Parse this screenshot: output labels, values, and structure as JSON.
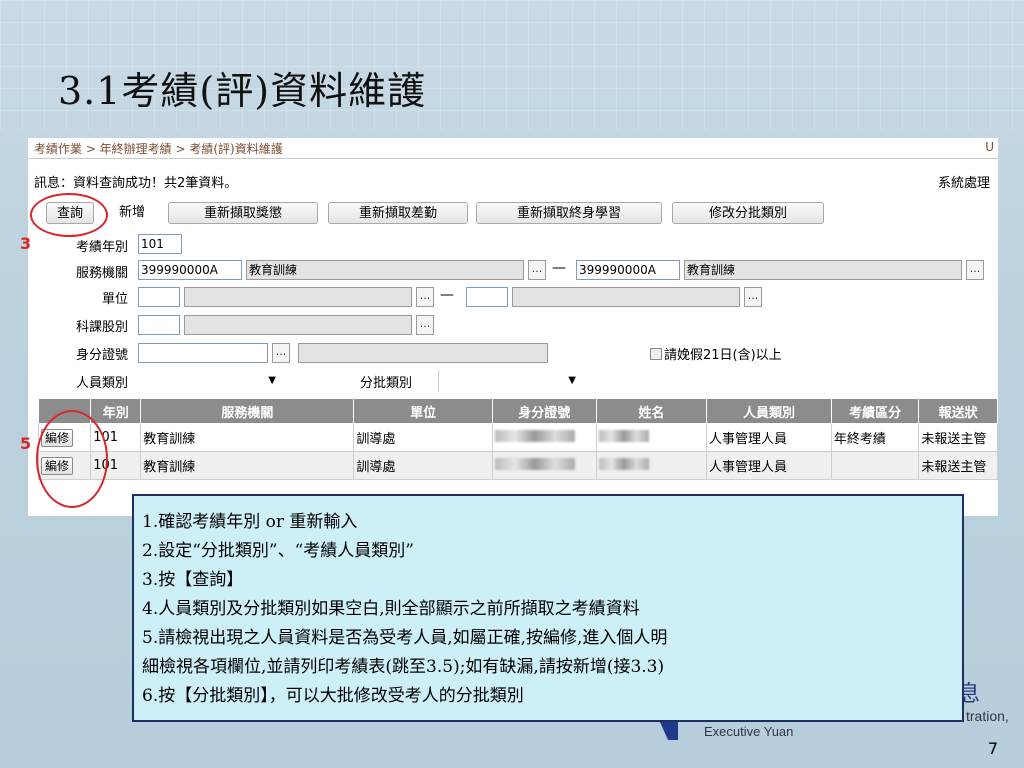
{
  "slide": {
    "title": "3.1考績(評)資料維護",
    "page_number": "7",
    "logo_text_1": "tration,",
    "logo_text_2": "Executive Yuan",
    "logo_glyph": "息"
  },
  "app": {
    "breadcrumb": "考績作業 > 年終辦理考績 > 考績(評)資料維護",
    "crumb_right": "U",
    "message": "訊息：資料查詢成功！共2筆資料。",
    "system": "系統處理"
  },
  "toolbar": {
    "query": "查詢",
    "add": "新增",
    "refetch_awards": "重新擷取獎懲",
    "refetch_diff": "重新擷取差勤",
    "refetch_learning": "重新擷取終身學習",
    "edit_batch": "修改分批類別"
  },
  "form": {
    "year_label": "考績年別",
    "year_value": "101",
    "agency_label": "服務機關",
    "agency_code_from": "399990000A",
    "agency_name_from": "教育訓練",
    "agency_code_to": "399990000A",
    "agency_name_to": "教育訓練",
    "unit_label": "單位",
    "section_label": "科課股別",
    "id_label": "身分證號",
    "leave_checkbox_label": "請娩假21日(含)以上",
    "staff_type_label": "人員類別",
    "batch_label": "分批類別",
    "lookup": "...",
    "range_dash": "—"
  },
  "table": {
    "headers": [
      "年別",
      "服務機關",
      "單位",
      "身分證號",
      "姓名",
      "人員類別",
      "考績區分",
      "報送狀"
    ],
    "rows": [
      {
        "action": "編修",
        "year": "101",
        "agency": "教育訓練",
        "unit": "訓導處",
        "staff_type": "人事管理人員",
        "category": "年終考績",
        "status": "未報送主管"
      },
      {
        "action": "編修",
        "year": "101",
        "agency": "教育訓練",
        "unit": "訓導處",
        "staff_type": "人事管理人員",
        "category": "",
        "status": "未報送主管"
      }
    ]
  },
  "annotations": {
    "step3": "3",
    "step5": "5"
  },
  "notes": [
    "1.確認考績年別 or 重新輸入",
    "2.設定“分批類別”、“考績人員類別”",
    "3.按【查詢】",
    "4.人員類別及分批類別如果空白,則全部顯示之前所擷取之考績資料",
    "5.請檢視出現之人員資料是否為受考人員,如屬正確,按編修,進入個人明",
    "細檢視各項欄位,並請列印考績表(跳至3.5);如有缺漏,請按新增(接3.3)",
    "6.按【分批類別】，可以大批修改受考人的分批類別"
  ],
  "colors": {
    "accent_red": "#d8262b",
    "header_gray": "#8c8c8c",
    "note_bg": "#cdeff8",
    "note_border": "#1e2e63"
  }
}
